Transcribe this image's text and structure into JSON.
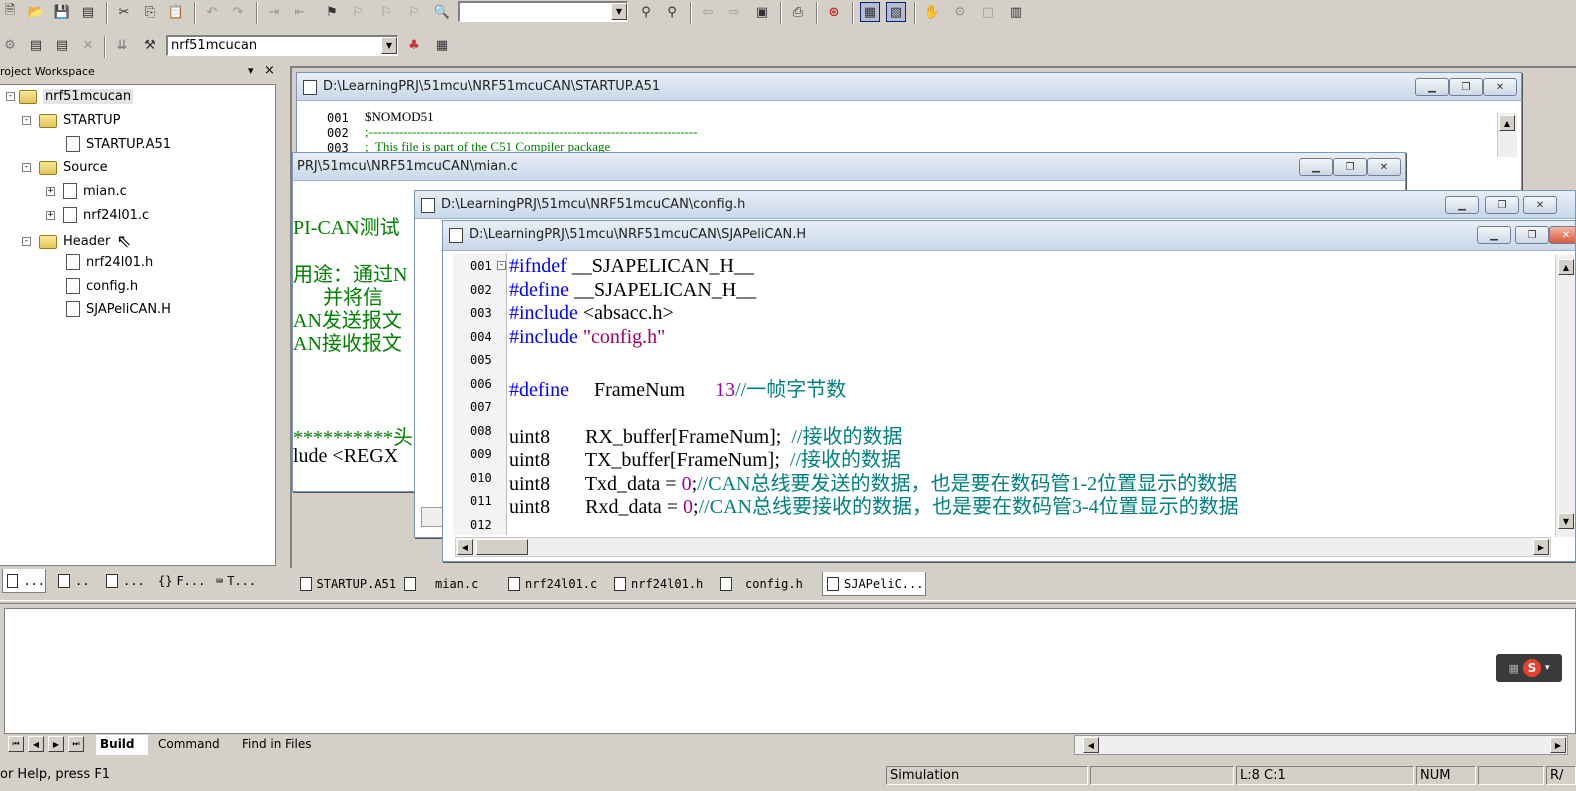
{
  "toolbar1": {
    "find_combo_value": ""
  },
  "toolbar2": {
    "target_combo_value": "nrf51mcucan"
  },
  "workspace": {
    "title": "roject Workspace",
    "pin_glyph": "▾",
    "close_glyph": "×",
    "tree": {
      "root": "nrf51mcucan",
      "groups": [
        {
          "label": "STARTUP",
          "files": [
            "STARTUP.A51"
          ]
        },
        {
          "label": "Source",
          "files": [
            "mian.c",
            "nrf24l01.c"
          ]
        },
        {
          "label": "Header",
          "files": [
            "nrf24l01.h",
            "config.h",
            "SJAPeliCAN.H"
          ]
        }
      ]
    },
    "bottom_tabs": [
      "...",
      "..",
      "...",
      "F...",
      "T..."
    ]
  },
  "windows": {
    "startup": {
      "title": "D:\\LearningPRJ\\51mcu\\NRF51mcuCAN\\STARTUP.A51",
      "lines": [
        {
          "n": "001",
          "text": "$NOMOD51"
        },
        {
          "n": "002",
          "text": ";----------------------------------------------------------------------------"
        },
        {
          "n": "003",
          "text": ";  This file is part of the C51 Compiler package"
        }
      ]
    },
    "mian": {
      "title": "PRJ\\51mcu\\NRF51mcuCAN\\mian.c",
      "lines": [
        "PI-CAN测试",
        "",
        "用途：通过N",
        "      并将信",
        "AN发送报文",
        "AN接收报文",
        "",
        "",
        "**********头",
        "lude <REGX"
      ]
    },
    "config": {
      "title": "D:\\LearningPRJ\\51mcu\\NRF51mcuCAN\\config.h"
    },
    "sja": {
      "title": "D:\\LearningPRJ\\51mcu\\NRF51mcuCAN\\SJAPeliCAN.H",
      "line_numbers": [
        "001",
        "002",
        "003",
        "004",
        "005",
        "006",
        "007",
        "008",
        "009",
        "010",
        "011",
        "012"
      ],
      "code": {
        "l1_kw": "#ifndef",
        "l1_rest": " __SJAPELICAN_H__",
        "l2_kw": "#define",
        "l2_rest": " __SJAPELICAN_H__",
        "l3_kw": "#include",
        "l3_rest": " <absacc.h>",
        "l4_kw": "#include",
        "l4_str": " \"config.h\"",
        "l6_kw": "#define",
        "l6_mid": "     FrameNum      ",
        "l6_num": "13",
        "l6_cm": "//一帧字节数",
        "l8_a": "uint8       RX_buffer[FrameNum];  ",
        "l8_cm": "//接收的数据",
        "l9_a": "uint8       TX_buffer[FrameNum];  ",
        "l9_cm": "//接收的数据",
        "l10_a": "uint8       Txd_data = ",
        "l10_num": "0",
        "l10_b": ";",
        "l10_cm": "//CAN总线要发送的数据，也是要在数码管1-2位置显示的数据",
        "l11_a": "uint8       Rxd_data = ",
        "l11_num": "0",
        "l11_b": ";",
        "l11_cm": "//CAN总线要接收的数据，也是要在数码管3-4位置显示的数据"
      }
    }
  },
  "editor_tabs": [
    "STARTUP.A51",
    "mian.c",
    "nrf24l01.c",
    "nrf24l01.h",
    "config.h",
    "SJAPeliC..."
  ],
  "output": {
    "tabs": [
      "Build",
      "Command",
      "Find in Files"
    ]
  },
  "statusbar": {
    "help": "or Help, press F1",
    "mode": "Simulation",
    "position": "L:8 C:1",
    "num": "NUM",
    "rw": "R/"
  },
  "colors": {
    "keyword": "#0000ff",
    "comment": "#008080",
    "string": "#a00060",
    "number": "#a000a0"
  }
}
